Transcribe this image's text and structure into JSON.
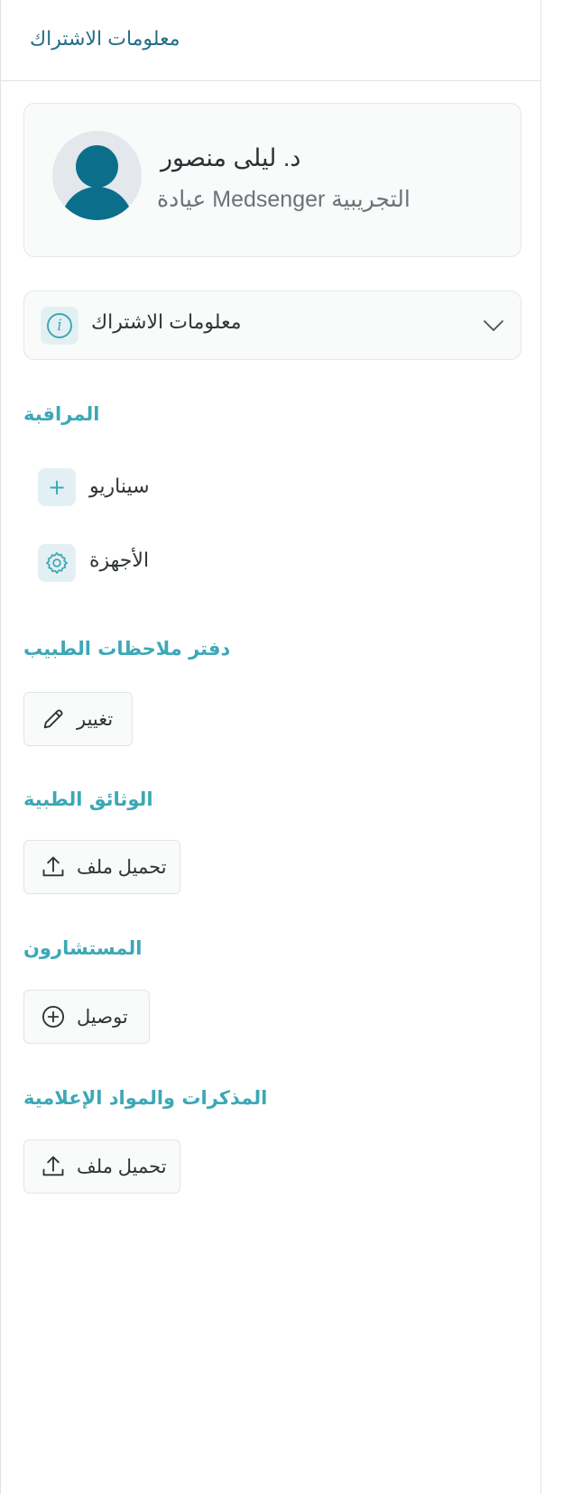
{
  "header": {
    "title": "معلومات الاشتراك"
  },
  "profile": {
    "name": "د. ليلى منصور",
    "clinic": "التجريبية Medsenger عيادة"
  },
  "subscription": {
    "label": "معلومات الاشتراك"
  },
  "monitoring": {
    "title": "المراقبة",
    "items": [
      {
        "label": "سيناريو",
        "icon": "plus-icon"
      },
      {
        "label": "الأجهزة",
        "icon": "gear-icon"
      }
    ]
  },
  "notes": {
    "title": "دفتر ملاحظات الطبيب",
    "button": "تغيير"
  },
  "documents": {
    "title": "الوثائق الطبية",
    "button": "تحميل ملف"
  },
  "consultants": {
    "title": "المستشارون",
    "button": "توصيل"
  },
  "reminders": {
    "title": "المذكرات والمواد الإعلامية",
    "button": "تحميل ملف"
  },
  "colors": {
    "accent": "#3ca8b6",
    "brand": "#0b6f8c",
    "card_bg": "#f9fafa"
  }
}
